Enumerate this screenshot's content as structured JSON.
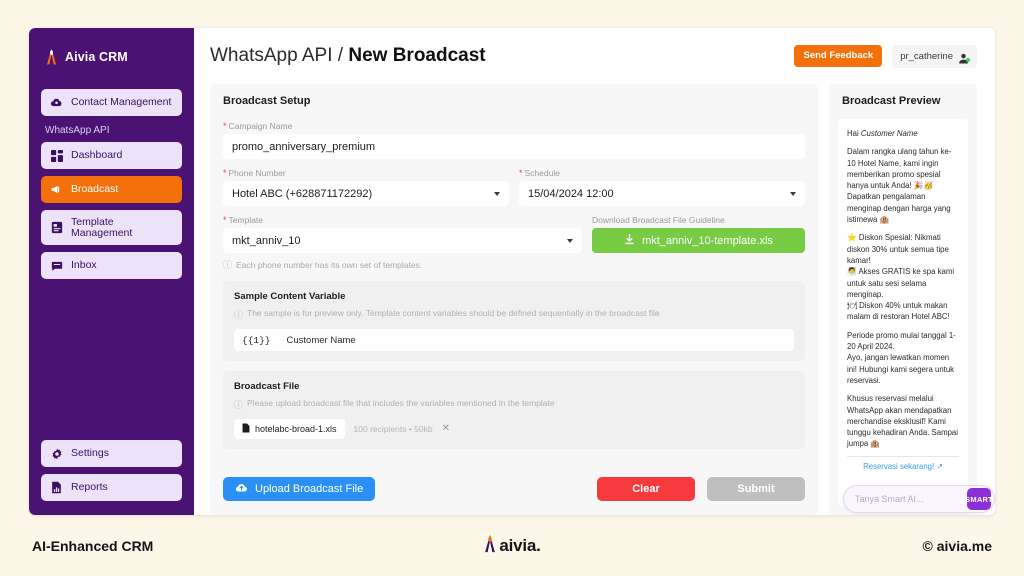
{
  "footer": {
    "left": "AI-Enhanced CRM",
    "logo_text": "aivia.",
    "right": "© aivia.me"
  },
  "sidebar": {
    "brand": "Aivia CRM",
    "top_items": [
      {
        "label": "Contact Management",
        "icon": "contacts-cloud-icon",
        "active": false
      }
    ],
    "group_label": "WhatsApp API",
    "group_items": [
      {
        "label": "Dashboard",
        "icon": "dashboard-grid-icon",
        "active": false
      },
      {
        "label": "Broadcast",
        "icon": "megaphone-icon",
        "active": true
      },
      {
        "label": "Template Management",
        "icon": "template-icon",
        "active": false
      },
      {
        "label": "Inbox",
        "icon": "chat-inbox-icon",
        "active": false
      }
    ],
    "bottom_items": [
      {
        "label": "Settings",
        "icon": "gear-icon",
        "active": false
      },
      {
        "label": "Reports",
        "icon": "report-file-icon",
        "active": false
      }
    ],
    "accent_active": "#f4700a",
    "background": "#4a1273"
  },
  "header": {
    "breadcrumb_parent": "WhatsApp API",
    "breadcrumb_sep": " / ",
    "breadcrumb_current": "New Broadcast",
    "feedback_label": "Send Feedback",
    "user_name": "pr_catherine"
  },
  "setup": {
    "title": "Broadcast Setup",
    "campaign": {
      "label": "Campaign Name",
      "value": "promo_anniversary_premium",
      "required": true
    },
    "phone": {
      "label": "Phone Number",
      "value": "Hotel ABC (+628871172292)",
      "required": true
    },
    "schedule": {
      "label": "Schedule",
      "value": "15/04/2024 12:00",
      "required": true
    },
    "template": {
      "label": "Template",
      "value": "mkt_anniv_10",
      "required": true,
      "hint": "Each phone number has its own set of templates."
    },
    "download": {
      "label": "Download Broadcast File Guideline",
      "button_label": "mkt_anniv_10-template.xls"
    },
    "sample": {
      "title": "Sample Content Variable",
      "note": "The sample is for preview only. Template content variables should be defined sequentially in the broadcast file",
      "variables": [
        {
          "key": "{{1}}",
          "value": "Customer Name"
        }
      ]
    },
    "broadcast_file": {
      "title": "Broadcast File",
      "note": "Please upload broadcast file that includes the variables mentioned in the template",
      "file_name": "hotelabc-broad-1.xls",
      "file_meta": "100 recipients • 50kb",
      "remove_label": "✕"
    },
    "actions": {
      "upload_label": "Upload Broadcast File",
      "clear_label": "Clear",
      "submit_label": "Submit"
    }
  },
  "preview": {
    "title": "Broadcast Preview",
    "greeting_prefix": "Hai ",
    "greeting_variable": "Customer Name",
    "paragraphs": [
      "Dalam rangka ulang tahun ke-10 Hotel Name, kami ingin memberikan promo spesial hanya untuk Anda! 🎉🥳 Dapatkan pengalaman menginap dengan harga yang istimewa 🏨",
      "⭐ Diskon Spesial: Nikmati diskon 30% untuk semua tipe kamar!\n🧖 Akses GRATIS ke spa kami untuk satu sesi selama menginap.\n🍽 Diskon 40% untuk makan malam di restoran Hotel ABC!",
      "Periode promo mulai tanggal 1-20 April 2024.\nAyo, jangan lewatkan momen ini! Hubungi kami segera untuk reservasi.",
      "Khusus reservasi melalui WhatsApp akan mendapatkan merchandise eksklusif! Kami tunggu kehadiran Anda. Sampai jumpa 🏨"
    ],
    "cta_label": "Reservasi sekarang!  ↗"
  },
  "ai_widget": {
    "placeholder": "Tanya Smart AI...",
    "badge_label": "SMART"
  }
}
